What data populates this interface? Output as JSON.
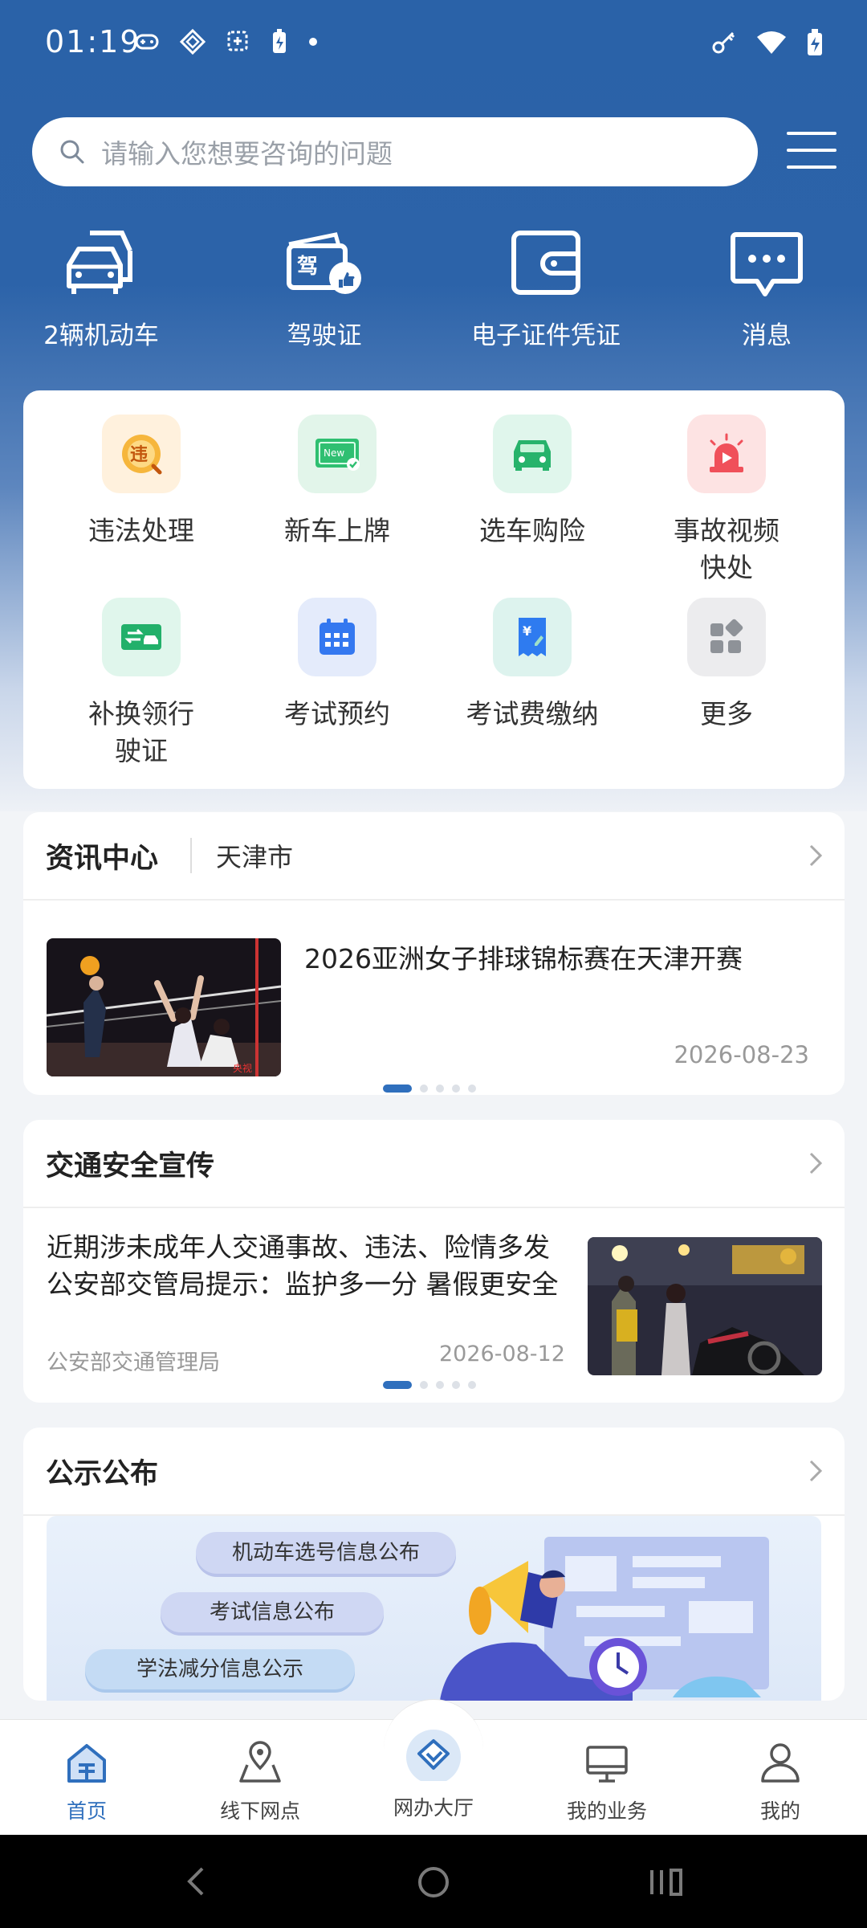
{
  "status_bar": {
    "time": "01:19"
  },
  "search": {
    "placeholder": "请输入您想要咨询的问题"
  },
  "top_nav": [
    {
      "label": "2辆机动车",
      "icon": "cars-icon"
    },
    {
      "label": "驾驶证",
      "icon": "license-icon"
    },
    {
      "label": "电子证件凭证",
      "icon": "wallet-icon"
    },
    {
      "label": "消息",
      "icon": "message-icon"
    }
  ],
  "services": [
    {
      "label": "违法处理",
      "icon": "violation-icon"
    },
    {
      "label": "新车上牌",
      "icon": "new-plate-icon"
    },
    {
      "label": "选车购险",
      "icon": "car-insurance-icon"
    },
    {
      "label": "事故视频快处",
      "icon": "accident-video-icon"
    },
    {
      "label": "补换领行驶证",
      "icon": "renew-license-icon"
    },
    {
      "label": "考试预约",
      "icon": "calendar-icon"
    },
    {
      "label": "考试费缴纳",
      "icon": "fee-icon"
    },
    {
      "label": "更多",
      "icon": "more-icon"
    }
  ],
  "news": {
    "title": "资讯中心",
    "city": "天津市",
    "headline": "2026亚洲女子排球锦标赛在天津开赛",
    "date": "2026-08-23",
    "pager_total": 5,
    "pager_active": 0
  },
  "safety": {
    "title": "交通安全宣传",
    "headline": "近期涉未成年人交通事故、违法、险情多发 公安部交管局提示：监护多一分 暑假更安全",
    "source": "公安部交通管理局",
    "date": "2026-08-12",
    "pager_total": 5,
    "pager_active": 0
  },
  "notice": {
    "title": "公示公布",
    "pills": [
      "机动车选号信息公布",
      "考试信息公布",
      "学法减分信息公示"
    ]
  },
  "bottom_nav": [
    {
      "label": "首页",
      "icon": "home-icon",
      "active": true
    },
    {
      "label": "线下网点",
      "icon": "map-pin-icon",
      "active": false
    },
    {
      "label": "网办大厅",
      "icon": "online-hall-icon",
      "active": false
    },
    {
      "label": "我的业务",
      "icon": "monitor-icon",
      "active": false
    },
    {
      "label": "我的",
      "icon": "user-icon",
      "active": false
    }
  ],
  "colors": {
    "primary": "#2f6fbd",
    "header": "#2b62a8"
  }
}
